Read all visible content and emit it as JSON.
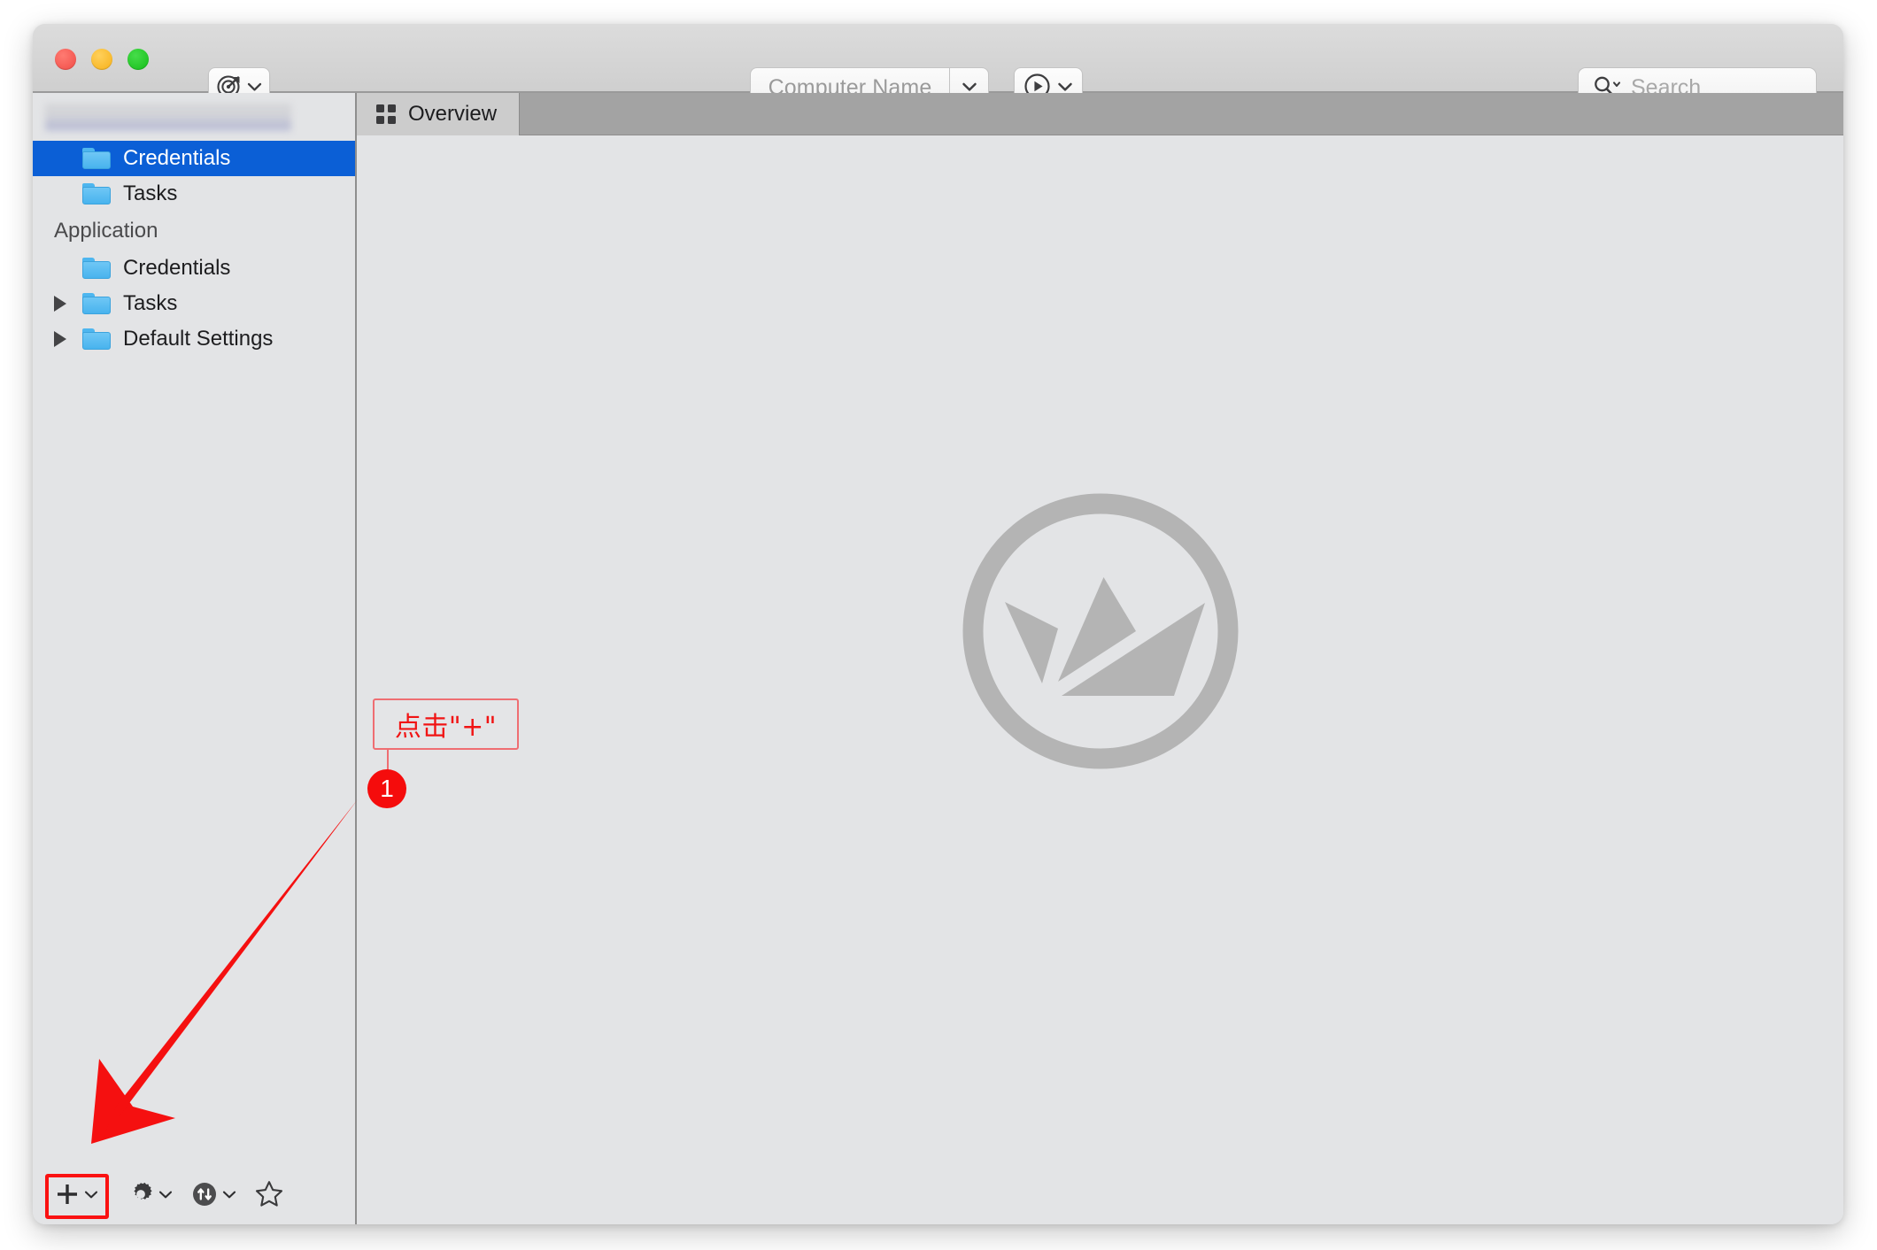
{
  "window": {
    "traffic_lights": [
      "close",
      "minimize",
      "maximize"
    ],
    "colors": {
      "close": "#f04b45",
      "minimize": "#f6b018",
      "maximize": "#14bc17",
      "selection_blue": "#0b5fd6",
      "annotation_red": "#f50c0c",
      "window_bg": "#e3e4e6",
      "tabbar_bg": "#a3a3a3",
      "active_tab_bg": "#cccccc"
    }
  },
  "toolbar": {
    "target_icon": "target-radar-icon",
    "target_chevron": "chevron-down-icon",
    "computer_name": {
      "value": "",
      "placeholder": "Computer Name",
      "chevron": "chevron-down-icon"
    },
    "run": {
      "icon": "play-circle-icon",
      "chevron": "chevron-down-icon"
    },
    "search": {
      "icon": "search-icon",
      "chevron": "chevron-down-icon",
      "value": "",
      "placeholder": "Search"
    }
  },
  "sidebar": {
    "header_redacted": true,
    "top_items": [
      {
        "label": "Credentials",
        "icon": "folder-icon",
        "selected": true,
        "has_disclosure": false
      },
      {
        "label": "Tasks",
        "icon": "folder-icon",
        "selected": false,
        "has_disclosure": false
      }
    ],
    "group_label": "Application",
    "group_items": [
      {
        "label": "Credentials",
        "icon": "folder-icon",
        "selected": false,
        "has_disclosure": false
      },
      {
        "label": "Tasks",
        "icon": "folder-icon",
        "selected": false,
        "has_disclosure": true
      },
      {
        "label": "Default Settings",
        "icon": "folder-icon",
        "selected": false,
        "has_disclosure": true
      }
    ],
    "bottom_toolbar": [
      {
        "name": "add-button",
        "icon": "plus-icon",
        "chevron": true,
        "highlighted": true
      },
      {
        "name": "settings-button",
        "icon": "gear-icon",
        "chevron": true,
        "highlighted": false
      },
      {
        "name": "sync-button",
        "icon": "sync-arrows-icon",
        "chevron": true,
        "highlighted": false
      },
      {
        "name": "favorite-button",
        "icon": "star-outline-icon",
        "chevron": false,
        "highlighted": false
      }
    ]
  },
  "content": {
    "tabs": [
      {
        "label": "Overview",
        "icon": "grid-icon",
        "active": true
      }
    ],
    "watermark_icon": "jamf-boat-logo"
  },
  "annotation": {
    "callout_text": "点击\"+\"",
    "step_number": "1",
    "arrow": "red-arrow-pointing-to-add-button"
  }
}
